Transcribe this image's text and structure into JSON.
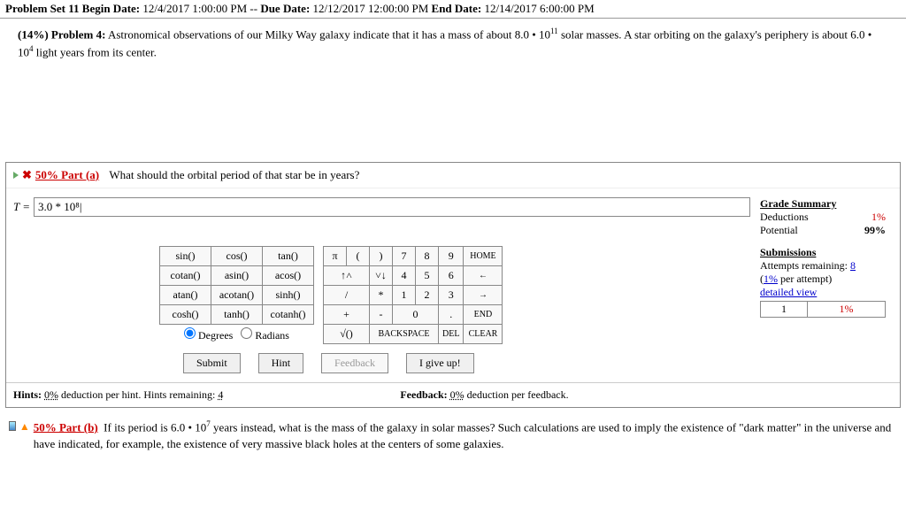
{
  "header": {
    "ps_label": "Problem Set 11 Begin Date:",
    "begin": "12/4/2017 1:00:00 PM",
    "sep": "--",
    "due_label": "Due Date:",
    "due": "12/12/2017 12:00:00 PM",
    "end_label": "End Date:",
    "end": "12/14/2017 6:00:00 PM"
  },
  "problem": {
    "prefix": "(14%) Problem 4:",
    "text1": "Astronomical observations of our Milky Way galaxy indicate that it has a mass of about 8.0 • 10",
    "exp1": "11",
    "text2": " solar masses. A star orbiting on the galaxy's periphery is about 6.0 • 10",
    "exp2": "4",
    "text3": " light years from its center."
  },
  "part_a": {
    "percent": "50% Part (a)",
    "question": "What should the orbital period of that star be in years?",
    "var": "T =",
    "input_value": "3.0 * 10⁸|"
  },
  "grade": {
    "title": "Grade Summary",
    "ded_label": "Deductions",
    "ded_val": "1%",
    "pot_label": "Potential",
    "pot_val": "99%"
  },
  "subs": {
    "title": "Submissions",
    "attempts_label": "Attempts remaining:",
    "attempts_val": "8",
    "per_attempt": "(1% per attempt)",
    "detailed": "detailed view",
    "row1_a": "1",
    "row1_b": "1%"
  },
  "fns": {
    "r1": [
      "sin()",
      "cos()",
      "tan()"
    ],
    "r2": [
      "cotan()",
      "asin()",
      "acos()"
    ],
    "r3": [
      "atan()",
      "acotan()",
      "sinh()"
    ],
    "r4": [
      "cosh()",
      "tanh()",
      "cotanh()"
    ]
  },
  "degrad": {
    "deg": "Degrees",
    "rad": "Radians"
  },
  "nums": {
    "r1": [
      "π",
      "(",
      ")",
      "7",
      "8",
      "9",
      "HOME"
    ],
    "r2": [
      "↑˄",
      "˅↓",
      "4",
      "5",
      "6",
      "←"
    ],
    "r3": [
      "/",
      "*",
      "1",
      "2",
      "3",
      "→"
    ],
    "r4": [
      "+",
      "-",
      "0",
      ".",
      "END"
    ],
    "r5": [
      "√()",
      "BACKSPACE",
      "DEL",
      "CLEAR"
    ]
  },
  "actions": {
    "submit": "Submit",
    "hint": "Hint",
    "feedback": "Feedback",
    "giveup": "I give up!"
  },
  "hints": {
    "label": "Hints:",
    "pct": "0%",
    "text": "deduction per hint. Hints remaining:",
    "remaining": "4",
    "fb_label": "Feedback:",
    "fb_pct": "0%",
    "fb_text": "deduction per feedback."
  },
  "part_b": {
    "percent": "50% Part (b)",
    "text1": "If its period is 6.0 • 10",
    "exp1": "7",
    "text2": " years instead, what is the mass of the galaxy in solar masses? Such calculations are used to imply the existence of \"dark matter\" in the universe and have indicated, for example, the existence of very massive black holes at the centers of some galaxies."
  }
}
